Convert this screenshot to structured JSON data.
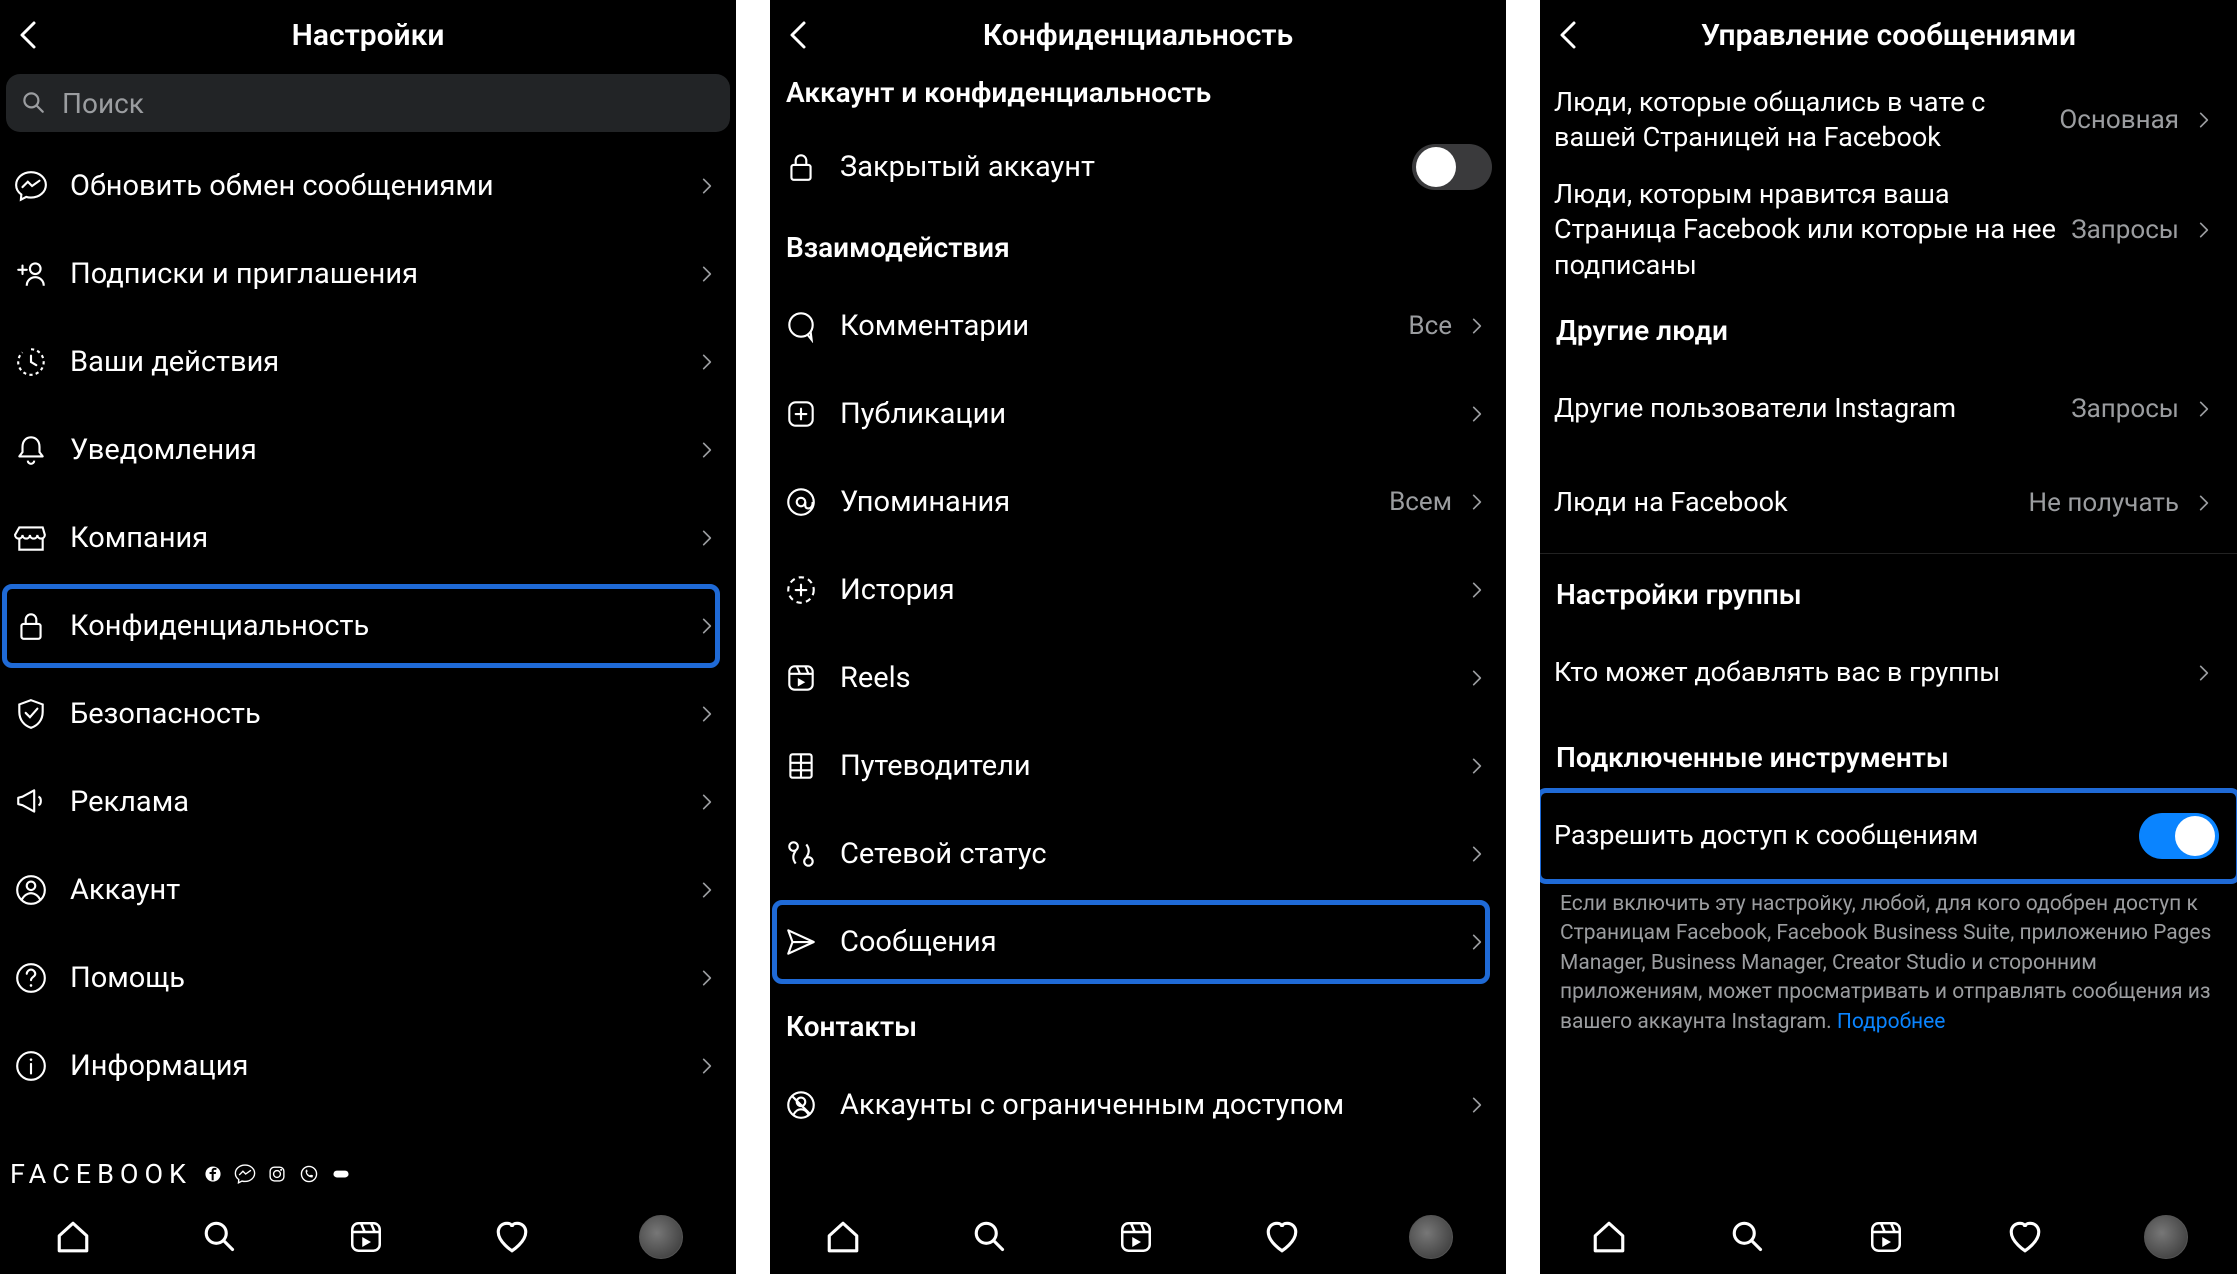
{
  "panel1": {
    "title": "Настройки",
    "search_placeholder": "Поиск",
    "items": [
      {
        "icon": "messenger",
        "label": "Обновить обмен сообщениями"
      },
      {
        "icon": "person-plus",
        "label": "Подписки и приглашения"
      },
      {
        "icon": "activity",
        "label": "Ваши действия"
      },
      {
        "icon": "bell",
        "label": "Уведомления"
      },
      {
        "icon": "storefront",
        "label": "Компания"
      },
      {
        "icon": "lock",
        "label": "Конфиденциальность",
        "highlight": true
      },
      {
        "icon": "shield",
        "label": "Безопасность"
      },
      {
        "icon": "megaphone",
        "label": "Реклама"
      },
      {
        "icon": "account",
        "label": "Аккаунт"
      },
      {
        "icon": "help",
        "label": "Помощь"
      },
      {
        "icon": "info",
        "label": "Информация"
      }
    ],
    "footer_brand": "FACEBOOK"
  },
  "panel2": {
    "title": "Конфиденциальность",
    "section1": "Аккаунт и конфиденциальность",
    "private_account_label": "Закрытый аккаунт",
    "private_account_on": false,
    "section2": "Взаимодействия",
    "items2": [
      {
        "icon": "comment",
        "label": "Комментарии",
        "meta": "Все"
      },
      {
        "icon": "plus-box",
        "label": "Публикации",
        "meta": ""
      },
      {
        "icon": "mention",
        "label": "Упоминания",
        "meta": "Всем"
      },
      {
        "icon": "story",
        "label": "История",
        "meta": ""
      },
      {
        "icon": "reels",
        "label": "Reels",
        "meta": ""
      },
      {
        "icon": "guide",
        "label": "Путеводители",
        "meta": ""
      },
      {
        "icon": "network",
        "label": "Сетевой статус",
        "meta": ""
      },
      {
        "icon": "send",
        "label": "Сообщения",
        "meta": "",
        "highlight": true
      }
    ],
    "section3": "Контакты",
    "items3": [
      {
        "icon": "blocked",
        "label": "Аккаунты с ограниченным доступом"
      }
    ]
  },
  "panel3": {
    "title": "Управление сообщениями",
    "top_items": [
      {
        "label": "Люди, которые общались в чате с вашей Страницей на Facebook",
        "meta": "Основная"
      },
      {
        "label": "Люди, которым нравится ваша Страница Facebook или которые на нее подписаны",
        "meta": "Запросы"
      }
    ],
    "section_other": "Другие люди",
    "other_items": [
      {
        "label": "Другие пользователи Instagram",
        "meta": "Запросы"
      },
      {
        "label": "Люди на Facebook",
        "meta": "Не получать"
      }
    ],
    "section_group": "Настройки группы",
    "group_item_label": "Кто может добавлять вас в группы",
    "section_tools": "Подключенные инструменты",
    "allow_label": "Разрешить доступ к сообщениям",
    "allow_on": true,
    "desc": "Если включить эту настройку, любой, для кого одобрен доступ к Страницам Facebook, Facebook Business Suite, приложению Pages Manager, Business Manager, Creator Studio и сторонним приложениям, может просматривать и отправлять сообщения из вашего аккаунта Instagram.",
    "desc_link": "Подробнее"
  }
}
